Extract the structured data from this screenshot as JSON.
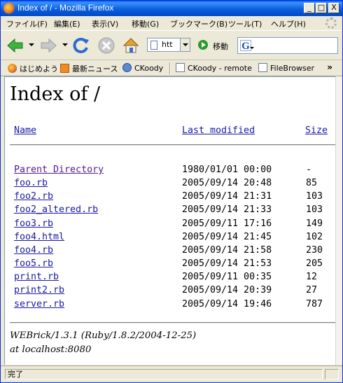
{
  "window": {
    "title": "Index of / - Mozilla Firefox",
    "buttons": {
      "minimize": "_",
      "maximize": "□",
      "close": "X"
    }
  },
  "menubar": {
    "items": [
      "ファイル(F)",
      "編集(E)",
      "表示(V)",
      "移動(G)",
      "ブックマーク(B)",
      "ツール(T)",
      "ヘルプ(H)"
    ]
  },
  "toolbar": {
    "url_value": "htt",
    "go_label": "移動",
    "icons": [
      "back-arrow-icon",
      "forward-arrow-icon",
      "reload-icon",
      "stop-icon",
      "home-icon",
      "go-icon",
      "google-search-icon"
    ]
  },
  "bookmarks": {
    "items": [
      "はじめよう",
      "最新ニュース",
      "CKoody",
      "CKoody - remote",
      "FileBrowser"
    ],
    "more": "»"
  },
  "page": {
    "heading": "Index of /",
    "columns": {
      "name": "Name",
      "modified": "Last modified",
      "size": "Size"
    },
    "rows": [
      {
        "name": "Parent Directory",
        "modified": "1980/01/01 00:00",
        "size": "-"
      },
      {
        "name": "foo.rb",
        "modified": "2005/09/14 20:48",
        "size": "85"
      },
      {
        "name": "foo2.rb",
        "modified": "2005/09/14 21:31",
        "size": "103"
      },
      {
        "name": "foo2_altered.rb",
        "modified": "2005/09/14 21:33",
        "size": "103"
      },
      {
        "name": "foo3.rb",
        "modified": "2005/09/11 17:16",
        "size": "149"
      },
      {
        "name": "foo4.html",
        "modified": "2005/09/14 21:45",
        "size": "102"
      },
      {
        "name": "foo4.rb",
        "modified": "2005/09/14 21:58",
        "size": "230"
      },
      {
        "name": "foo5.rb",
        "modified": "2005/09/14 21:53",
        "size": "205"
      },
      {
        "name": "print.rb",
        "modified": "2005/09/11 00:35",
        "size": "12"
      },
      {
        "name": "print2.rb",
        "modified": "2005/09/14 20:39",
        "size": "27"
      },
      {
        "name": "server.rb",
        "modified": "2005/09/14 19:46",
        "size": "787"
      }
    ],
    "footer_line1": "WEBrick/1.3.1 (Ruby/1.8.2/2004-12-25)",
    "footer_line2": "at localhost:8080"
  },
  "status": {
    "text": "完了"
  },
  "colors": {
    "link": "#1a1aa6",
    "visited": "#551a8b",
    "titlebar": "#0a5fdc"
  }
}
